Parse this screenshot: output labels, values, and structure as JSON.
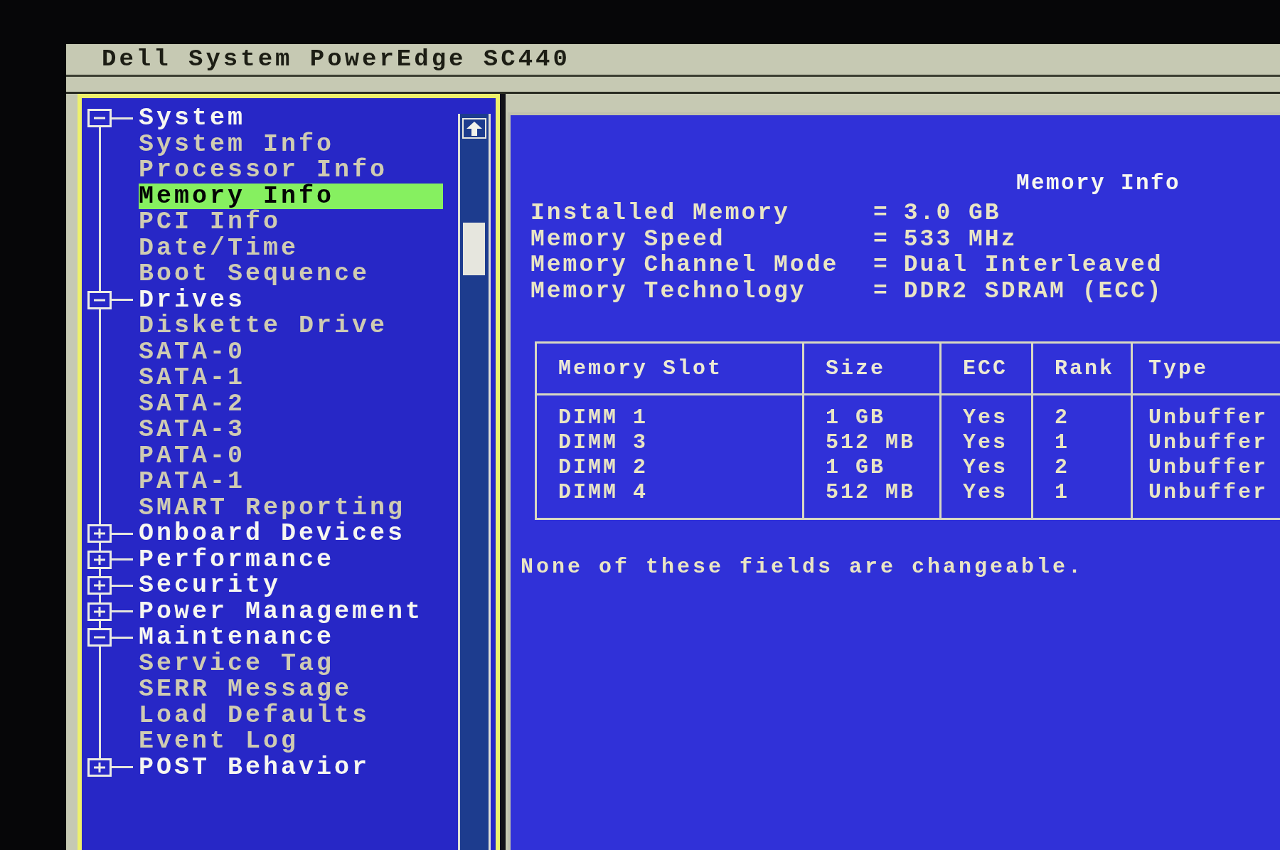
{
  "title_bar": {
    "title": "Dell System PowerEdge SC440"
  },
  "tree": [
    {
      "label": "System",
      "expanded": true,
      "selected": false,
      "children": [
        {
          "label": "System Info",
          "selected": false
        },
        {
          "label": "Processor Info",
          "selected": false
        },
        {
          "label": "Memory Info",
          "selected": true
        },
        {
          "label": "PCI Info",
          "selected": false
        },
        {
          "label": "Date/Time",
          "selected": false
        },
        {
          "label": "Boot Sequence",
          "selected": false
        }
      ]
    },
    {
      "label": "Drives",
      "expanded": true,
      "selected": false,
      "children": [
        {
          "label": "Diskette Drive",
          "selected": false
        },
        {
          "label": "SATA-0",
          "selected": false
        },
        {
          "label": "SATA-1",
          "selected": false
        },
        {
          "label": "SATA-2",
          "selected": false
        },
        {
          "label": "SATA-3",
          "selected": false
        },
        {
          "label": "PATA-0",
          "selected": false
        },
        {
          "label": "PATA-1",
          "selected": false
        },
        {
          "label": "SMART Reporting",
          "selected": false
        }
      ]
    },
    {
      "label": "Onboard Devices",
      "expanded": false,
      "selected": false
    },
    {
      "label": "Performance",
      "expanded": false,
      "selected": false
    },
    {
      "label": "Security",
      "expanded": false,
      "selected": false
    },
    {
      "label": "Power Management",
      "expanded": false,
      "selected": false
    },
    {
      "label": "Maintenance",
      "expanded": true,
      "selected": false,
      "children": [
        {
          "label": "Service Tag",
          "selected": false
        },
        {
          "label": "SERR Message",
          "selected": false
        },
        {
          "label": "Load Defaults",
          "selected": false
        },
        {
          "label": "Event Log",
          "selected": false
        }
      ]
    },
    {
      "label": "POST Behavior",
      "expanded": false,
      "selected": false
    }
  ],
  "info_panel": {
    "title": "Memory Info",
    "fields": [
      {
        "label": "Installed Memory",
        "separator": "=",
        "value": "3.0 GB"
      },
      {
        "label": "Memory Speed",
        "separator": "=",
        "value": "533 MHz"
      },
      {
        "label": "Memory Channel Mode",
        "separator": "=",
        "value": "Dual Interleaved"
      },
      {
        "label": "Memory Technology",
        "separator": "=",
        "value": "DDR2 SDRAM (ECC)"
      }
    ],
    "table": {
      "columns": [
        "Memory Slot",
        "Size",
        "ECC",
        "Rank",
        "Type"
      ],
      "rows": [
        [
          "DIMM 1",
          "1 GB",
          "Yes",
          "2",
          "Unbuffer"
        ],
        [
          "DIMM 3",
          "512 MB",
          "Yes",
          "1",
          "Unbuffer"
        ],
        [
          "DIMM 2",
          "1 GB",
          "Yes",
          "2",
          "Unbuffer"
        ],
        [
          "DIMM 4",
          "512 MB",
          "Yes",
          "1",
          "Unbuffer"
        ]
      ]
    },
    "note": "None of these fields are changeable."
  }
}
